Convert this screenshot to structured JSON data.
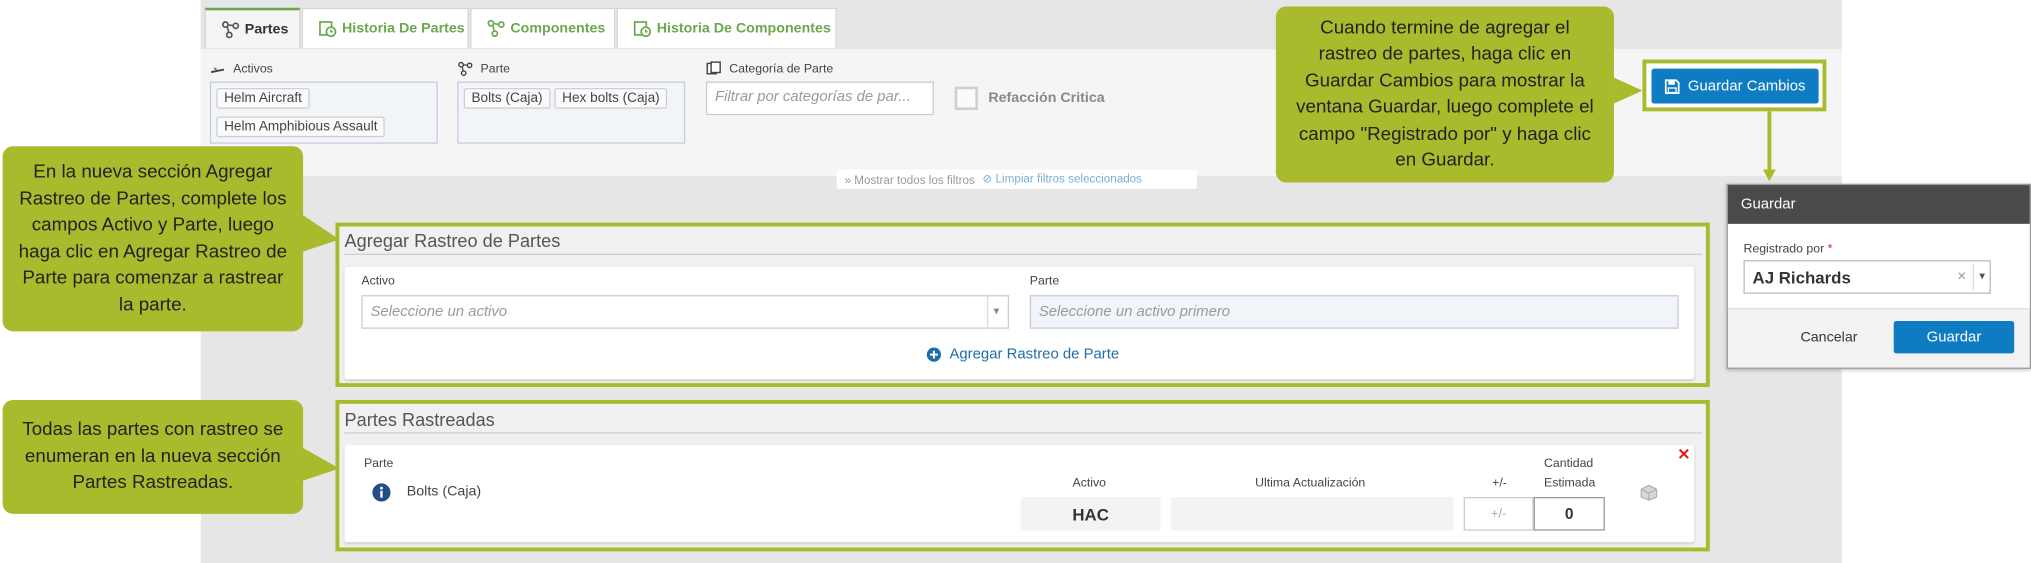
{
  "tabs": [
    {
      "label": "Partes",
      "active": true
    },
    {
      "label": "Historia De Partes",
      "active": false
    },
    {
      "label": "Componentes",
      "active": false
    },
    {
      "label": "Historia De Componentes",
      "active": false
    }
  ],
  "filters": {
    "activos_label": "Activos",
    "activos_chips": [
      "Helm Aircraft",
      "Helm Amphibious Assault"
    ],
    "parte_label": "Parte",
    "parte_chips": [
      "Bolts (Caja)",
      "Hex bolts (Caja)"
    ],
    "categoria_label": "Categoría de Parte",
    "categoria_placeholder": "Filtrar por categorías de par...",
    "refaccion_label": "Refacción Critica",
    "show_all": "Mostrar todos los filtros",
    "clear_selected": "Limpiar filtros seleccionados"
  },
  "save_changes_label": "Guardar Cambios",
  "add_tracking": {
    "title": "Agregar Rastreo de Partes",
    "activo_label": "Activo",
    "activo_placeholder": "Seleccione un activo",
    "parte_label": "Parte",
    "parte_placeholder": "Seleccione un activo primero",
    "add_link": "Agregar Rastreo de Parte"
  },
  "tracked": {
    "title": "Partes Rastreadas",
    "col_parte": "Parte",
    "col_activo": "Activo",
    "col_ultima": "Ultima Actualización",
    "col_plusminus": "+/-",
    "col_cantidad_1": "Cantidad",
    "col_cantidad_2": "Estimada",
    "row": {
      "part": "Bolts (Caja)",
      "activo": "HAC",
      "plusminus_placeholder": "+/-",
      "cantidad": "0"
    }
  },
  "dialog": {
    "title": "Guardar",
    "field_label": "Registrado por",
    "required_mark": "*",
    "value": "AJ Richards",
    "cancel": "Cancelar",
    "save": "Guardar"
  },
  "callouts": {
    "top": "Cuando termine de agregar el rastreo de partes, haga clic en Guardar Cambios para mostrar la ventana Guardar, luego complete el campo \"Registrado por\" y haga clic en Guardar.",
    "left_top": "En la nueva sección Agregar Rastreo de Partes, complete los campos Activo y Parte, luego haga clic en Agregar Rastreo de Parte para comenzar a rastrear la parte.",
    "left_bottom": "Todas las partes con rastreo se enumeran en la nueva sección Partes Rastreadas."
  },
  "colors": {
    "accent_green": "#a9ba2c",
    "tab_green": "#6aa84f",
    "button_blue": "#0f7bc3",
    "remove_red": "#e02020"
  }
}
